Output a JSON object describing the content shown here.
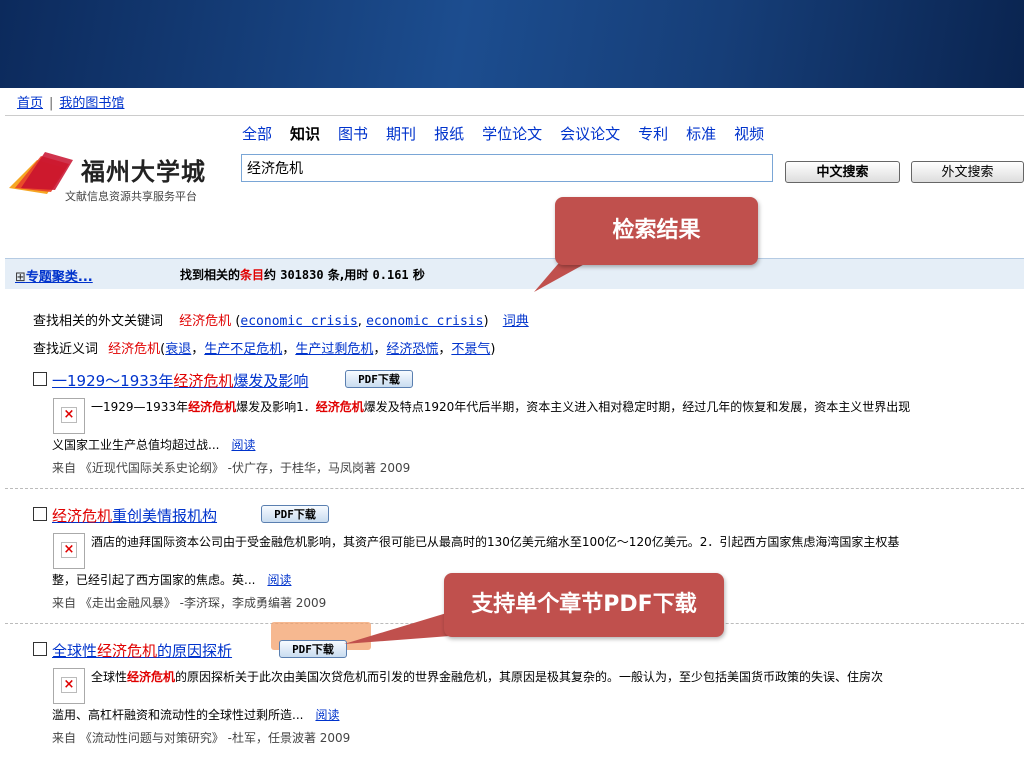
{
  "nav": {
    "home": "首页",
    "sep": "|",
    "library": "我的图书馆"
  },
  "logo": {
    "title": "福州大学城",
    "subtitle": "文献信息资源共享服务平台"
  },
  "categories": [
    "全部",
    "知识",
    "图书",
    "期刊",
    "报纸",
    "学位论文",
    "会议论文",
    "专利",
    "标准",
    "视频"
  ],
  "active_category": "知识",
  "search": {
    "value": "经济危机",
    "cn_button": "中文搜索",
    "en_button": "外文搜索"
  },
  "result_bar": {
    "topic_plus": "⊞",
    "topic_label": "专题聚类...",
    "found_prefix": "找到相关的",
    "found_red": "条目",
    "found_mid": "约",
    "count": "301830",
    "found_suffix": "条,用时",
    "time": "0.161",
    "time_unit": "秒"
  },
  "related": {
    "label": "查找相关的外文关键词",
    "keyword": "经济危机",
    "open": "(",
    "term1": "economic crisis",
    "comma": ",",
    "term2": "economic crisis",
    "close": ")",
    "dict": "词典"
  },
  "near": {
    "label": "查找近义词",
    "keyword": "经济危机",
    "open": "(",
    "terms": [
      "衰退",
      "生产不足危机",
      "生产过剩危机",
      "经济恐慌",
      "不景气"
    ],
    "close": ")"
  },
  "results": [
    {
      "title_pre": "一1929～1933年",
      "title_hl": "经济危机",
      "title_post": "爆发及影响",
      "pdf": "PDF下载",
      "abstract_pre": "一1929—1933年",
      "abstract_hl": "经济危机",
      "abstract_mid": "爆发及影响1．",
      "abstract_hl2": "经济危机",
      "abstract_post": "爆发及特点1920年代后半期，资本主义进入相对稳定时期，经过几年的恢复和发展，资本主义世界出现",
      "abstract2": "义国家工业生产总值均超过战...",
      "read": "阅读",
      "source": "来自  《近现代国际关系史论纲》 -伏广存，于桂华，马凤岗著  2009"
    },
    {
      "title_pre": "",
      "title_hl": "经济危机",
      "title_post": "重创美情报机构",
      "pdf": "PDF下载",
      "abstract_pre": "酒店的迪拜国际资本公司由于受金融危机影响，其资产很可能已从最高时的130亿美元缩水至100亿～120亿美元。2．引起西方国家焦虑海湾国家主权基",
      "abstract_hl": "",
      "abstract_mid": "",
      "abstract_hl2": "",
      "abstract_post": "",
      "abstract2": "整，已经引起了西方国家的焦虑。英...",
      "read": "阅读",
      "source": "来自  《走出金融风暴》 -李济琛，李成勇编著  2009"
    },
    {
      "title_pre": "全球性",
      "title_hl": "经济危机",
      "title_post": "的原因探析",
      "pdf": "PDF下载",
      "abstract_pre": "全球性",
      "abstract_hl": "经济危机",
      "abstract_mid": "的原因探析关于此次由美国次贷危机而引发的世界金融危机，其原因是极其复杂的。一般认为，至少包括美国货币政策的失误、住房次",
      "abstract_hl2": "",
      "abstract_post": "",
      "abstract2": "滥用、高杠杆融资和流动性的全球性过剩所造...",
      "read": "阅读",
      "source": "来自  《流动性问题与对策研究》 -杜军，任景波著  2009"
    }
  ],
  "callouts": {
    "results": "检索结果",
    "pdf": "支持单个章节PDF下载"
  },
  "colors": {
    "callout": "#c0504d",
    "link": "#0033cc",
    "highlight": "#e00000",
    "banner": "#1c4d8f"
  }
}
